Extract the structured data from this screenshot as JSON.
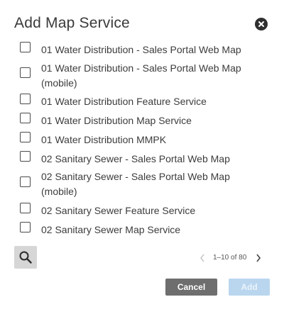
{
  "dialog": {
    "title": "Add Map Service",
    "close_icon": "close-circle-icon"
  },
  "services": [
    {
      "label": "01 Water Distribution - Sales Portal Web Map",
      "checked": false
    },
    {
      "label": "01 Water Distribution - Sales Portal Web Map (mobile)",
      "checked": false
    },
    {
      "label": "01 Water Distribution Feature Service",
      "checked": false
    },
    {
      "label": "01 Water Distribution Map Service",
      "checked": false
    },
    {
      "label": "01 Water Distribution MMPK",
      "checked": false
    },
    {
      "label": "02 Sanitary Sewer - Sales Portal Web Map",
      "checked": false
    },
    {
      "label": "02 Sanitary Sewer - Sales Portal Web Map (mobile)",
      "checked": false
    },
    {
      "label": "02 Sanitary Sewer Feature Service",
      "checked": false
    },
    {
      "label": "02 Sanitary Sewer Map Service",
      "checked": false
    }
  ],
  "search": {
    "icon": "search-icon"
  },
  "pagination": {
    "range_text": "1–10 of 80",
    "prev_icon": "chevron-left-icon",
    "next_icon": "chevron-right-icon"
  },
  "actions": {
    "cancel_label": "Cancel",
    "add_label": "Add"
  },
  "colors": {
    "cancel_bg": "#6e6e6e",
    "add_bg_disabled": "#b9d6ee",
    "search_bg": "#d6d6d6"
  }
}
